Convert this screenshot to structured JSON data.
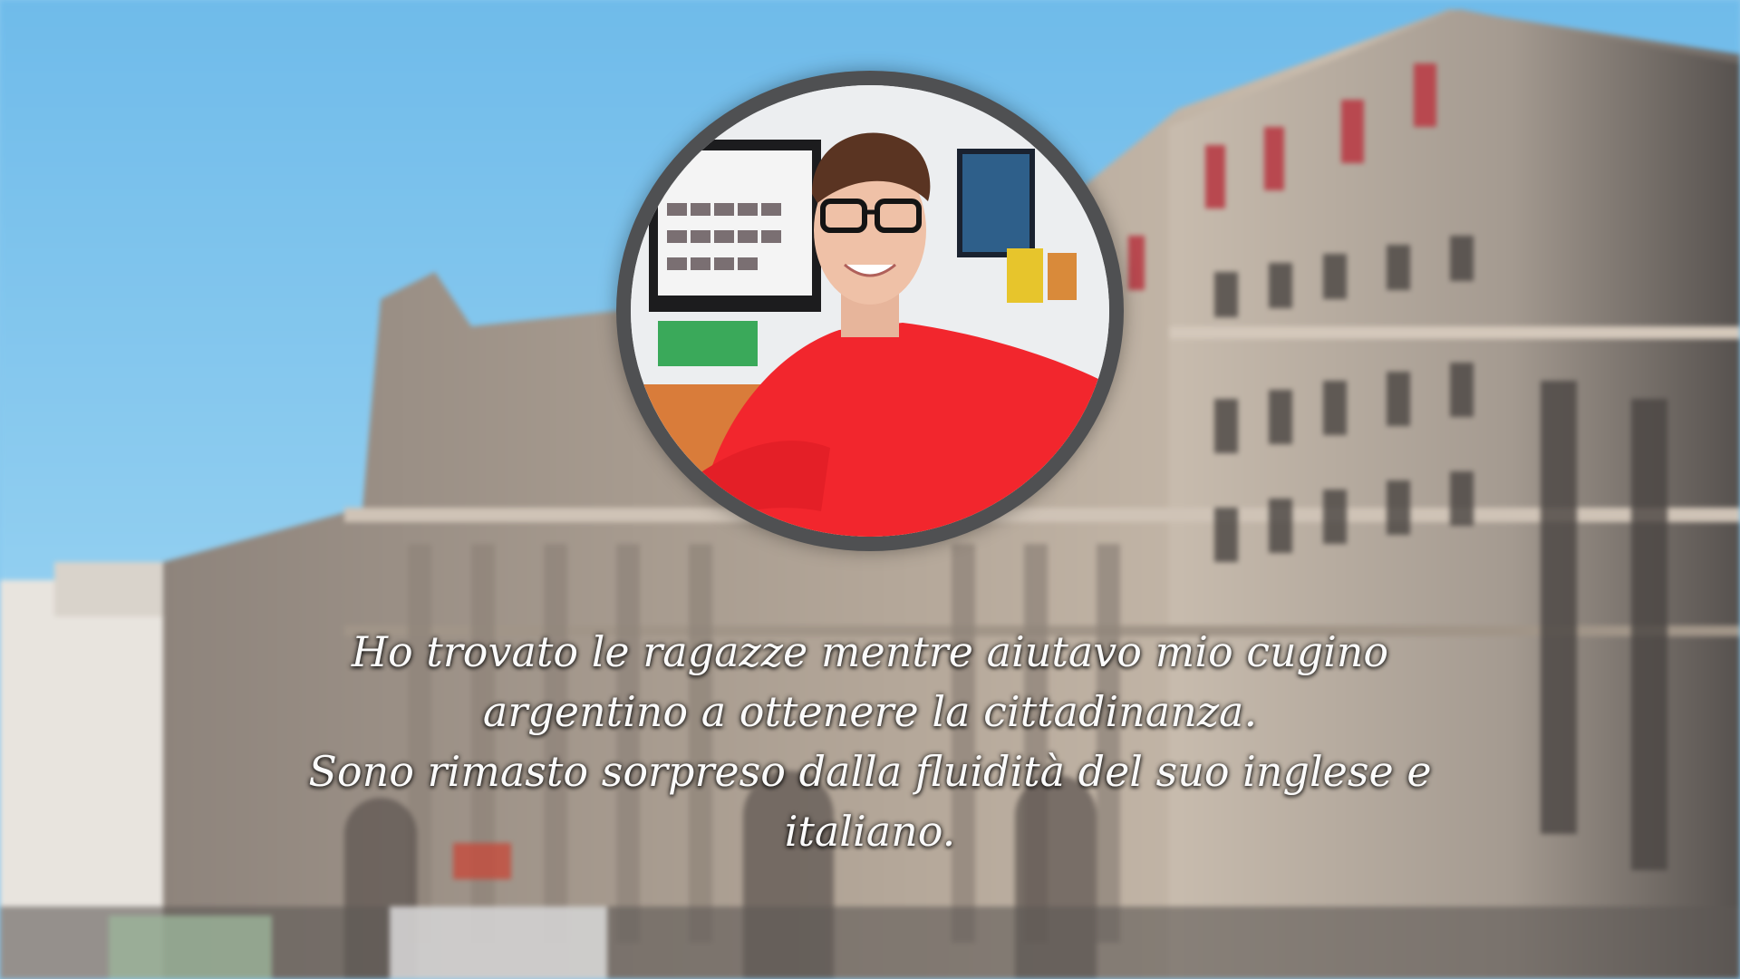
{
  "caption": {
    "lines": [
      "Ho trovato le ragazze mentre aiutavo mio cugino",
      "argentino a ottenere la cittadinanza.",
      "Sono rimasto sorpreso dalla fluidità del suo inglese e",
      "italiano."
    ]
  },
  "colors": {
    "sky": "#87c7ee",
    "building": "#b9ab9c",
    "roof_accent": "#b8484f",
    "shirt": "#f2262d",
    "frame": "#2d2d30",
    "caption_text": "#fbfbfb"
  },
  "icons": {
    "background": "building-background",
    "portrait": "man-portrait-photo"
  }
}
